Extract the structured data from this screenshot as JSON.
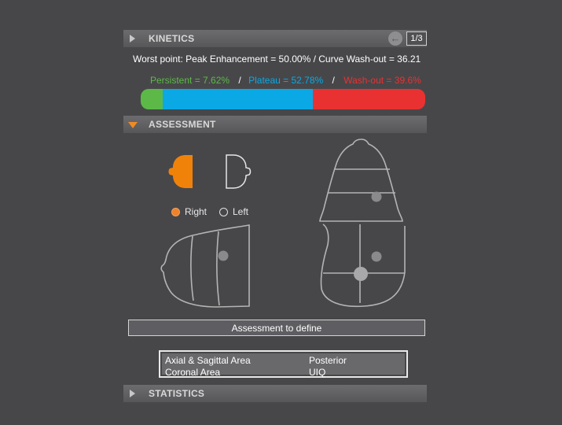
{
  "kinetics": {
    "title": "KINETICS",
    "back_icon": "arrow-left-icon",
    "page_indicator": "1/3",
    "worst_point": "Worst point: Peak Enhancement = 50.00% / Curve Wash-out = 36.21",
    "persistent_label": "Persistent = 7.62%",
    "plateau_label": "Plateau = 52.78%",
    "washout_label": "Wash-out = 39.6%",
    "separator": "/",
    "distribution": {
      "persistent": 7.62,
      "plateau": 52.78,
      "washout": 39.6
    },
    "colors": {
      "persistent": "#5cb947",
      "plateau": "#0aa9e6",
      "washout": "#ea3131"
    }
  },
  "assessment": {
    "title": "ASSESSMENT",
    "side_options": [
      {
        "label": "Right",
        "selected": true
      },
      {
        "label": "Left",
        "selected": false
      }
    ],
    "accent_color": "#f0820a",
    "button_label": "Assessment to define",
    "info": [
      {
        "key": "Axial & Sagittal Area",
        "value": "Posterior"
      },
      {
        "key": "Coronal Area",
        "value": "UIQ"
      }
    ]
  },
  "statistics": {
    "title": "STATISTICS"
  }
}
